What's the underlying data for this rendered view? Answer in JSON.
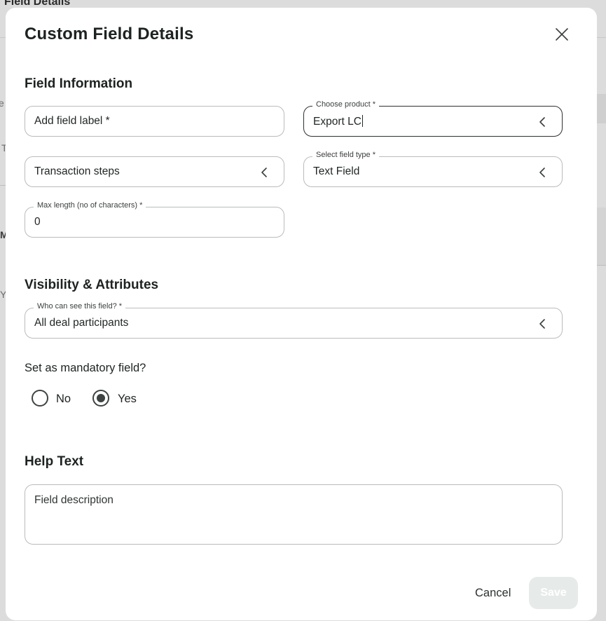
{
  "background": {
    "page_title": "Field Details",
    "fragments": [
      "e",
      "T",
      "M",
      "Y"
    ]
  },
  "modal": {
    "title": "Custom Field Details",
    "close_icon": "close-icon"
  },
  "sections": {
    "field_information": "Field Information",
    "visibility": "Visibility & Attributes",
    "help_text": "Help Text"
  },
  "fields": {
    "field_label": {
      "placeholder": "Add field label *"
    },
    "product": {
      "legend": "Choose product *",
      "value": "Export LC"
    },
    "transaction_steps": {
      "value": "Transaction steps"
    },
    "field_type": {
      "legend": "Select field type *",
      "value": "Text Field"
    },
    "max_length": {
      "legend": "Max length (no of characters) *",
      "value": "0"
    },
    "visibility": {
      "legend": "Who can see this field? *",
      "value": "All deal participants"
    }
  },
  "mandatory": {
    "question": "Set as mandatory field?",
    "options": [
      {
        "label": "No",
        "selected": false
      },
      {
        "label": "Yes",
        "selected": true
      }
    ]
  },
  "help": {
    "placeholder": "Field description"
  },
  "actions": {
    "cancel": "Cancel",
    "save": "Save",
    "save_enabled": false
  },
  "icons": {
    "dropdown": "chevron-left-icon",
    "close": "close-icon"
  }
}
